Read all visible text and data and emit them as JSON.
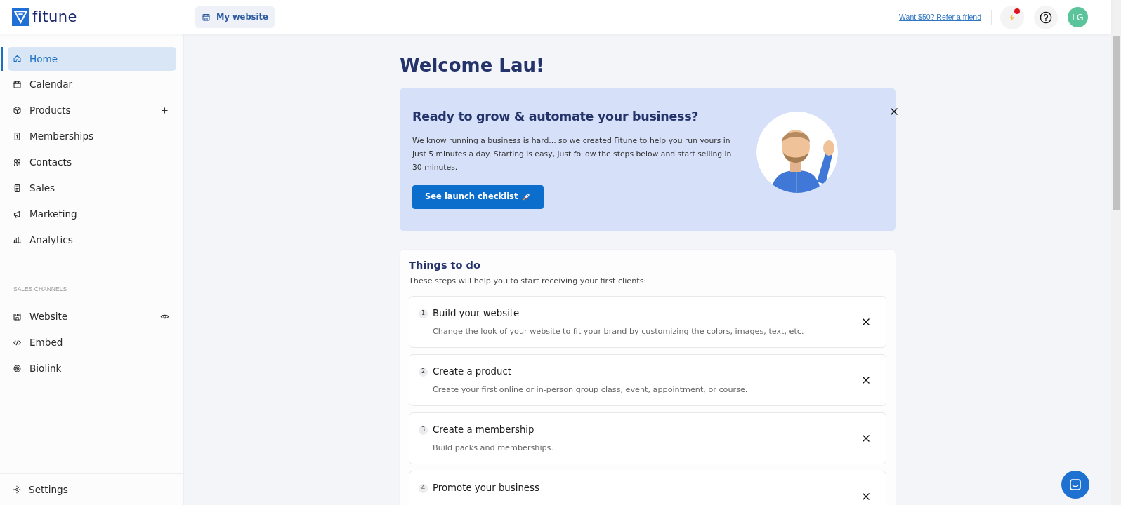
{
  "header": {
    "logo_text": "fitune",
    "site_button": "My website",
    "referral_link": "Want $50? Refer a friend",
    "notifications": {
      "unread": true
    },
    "avatar_initials": "LG"
  },
  "sidebar": {
    "items": [
      {
        "label": "Home",
        "selected": true
      },
      {
        "label": "Calendar",
        "selected": false
      },
      {
        "label": "Products",
        "selected": false
      },
      {
        "label": "Memberships",
        "selected": false
      },
      {
        "label": "Contacts",
        "selected": false
      },
      {
        "label": "Sales",
        "selected": false
      },
      {
        "label": "Marketing",
        "selected": false
      },
      {
        "label": "Analytics",
        "selected": false
      }
    ],
    "section_title": "SALES CHANNELS",
    "channels": [
      {
        "label": "Website",
        "selected": false
      },
      {
        "label": "Embed",
        "selected": false
      },
      {
        "label": "Biolink",
        "selected": false
      }
    ],
    "settings": "Settings"
  },
  "main": {
    "greeting": "Welcome Lau!",
    "banner": {
      "title": "Ready to grow & automate your business?",
      "text": "We know running a business is hard... so we created Fitune to help you run yours in just 5 minutes a day. Starting is easy, just follow the steps below and start selling in 30 minutes.",
      "button": "See launch checklist"
    },
    "todo": {
      "title": "Things to do",
      "subtitle": "These steps will help you to start receiving your first clients:",
      "steps": [
        {
          "number": "1",
          "title": "Build your website",
          "description": "Change the look of your website to fit your brand by customizing the colors, images, text, etc."
        },
        {
          "number": "2",
          "title": "Create a product",
          "description": "Create your first online or in-person group class, event, appointment, or course."
        },
        {
          "number": "3",
          "title": "Create a membership",
          "description": "Build packs and memberships."
        },
        {
          "number": "4",
          "title": "Promote your business"
        }
      ]
    }
  }
}
